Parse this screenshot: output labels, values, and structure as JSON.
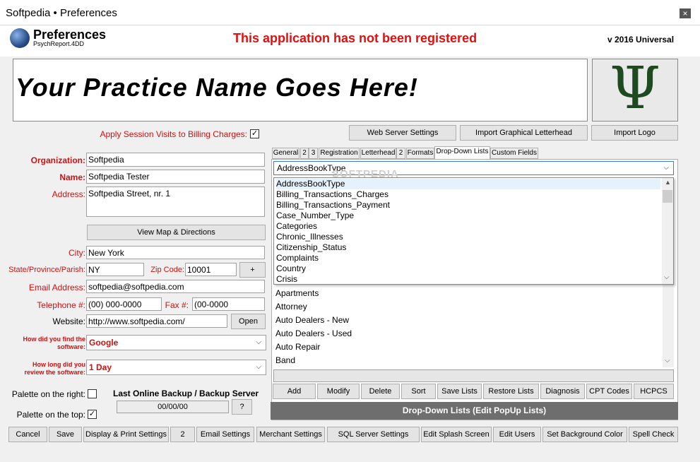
{
  "window": {
    "title": "Softpedia  • Preferences",
    "close_icon": "×"
  },
  "header": {
    "title": "Preferences",
    "subtitle": "PsychReport.4DD",
    "registration_notice": "This application has not been registered",
    "version": "v 2016 Universal"
  },
  "banner": {
    "practice_name": "Your Practice Name Goes Here!",
    "logo_glyph": "Ψ"
  },
  "options": {
    "apply_session_label": "Apply Session Visits to Billing Charges:",
    "apply_session_checked": "✓"
  },
  "top_buttons": {
    "web_server": "Web Server Settings",
    "import_letterhead": "Import Graphical Letterhead",
    "import_logo": "Import Logo"
  },
  "form": {
    "organization_label": "Organization:",
    "organization": "Softpedia",
    "name_label": "Name:",
    "name": "Softpedia Tester",
    "address_label": "Address:",
    "address": "Softpedia Street, nr. 1",
    "view_map": "View Map & Directions",
    "city_label": "City:",
    "city": "New York",
    "state_label": "State/Province/Parish:",
    "state": "NY",
    "zip_label": "Zip Code:",
    "zip": "10001",
    "plus": "+",
    "email_label": "Email Address:",
    "email": "softpedia@softpedia.com",
    "telephone_label": "Telephone #:",
    "telephone": "(00) 000-0000",
    "fax_label": "Fax #:",
    "fax": "(00-0000",
    "website_label": "Website:",
    "website": "http://www.softpedia.com/",
    "open": "Open",
    "found_label_1": "How did you find the",
    "found_label_2": "software:",
    "found_value": "Google",
    "review_label_1": "How long did you",
    "review_label_2": "review the software:",
    "review_value": "1 Day",
    "palette_right_label": "Palette on the right:",
    "palette_right_checked": "",
    "palette_top_label": "Palette on the top:",
    "palette_top_checked": "✓",
    "backup_title": "Last Online Backup / Backup Server",
    "backup_value": "00/00/00",
    "backup_help": "?"
  },
  "tabs": [
    "General",
    "2",
    "3",
    "Registration",
    "Letterhead",
    "2",
    "Formats",
    "Drop-Down Lists",
    "Custom Fields"
  ],
  "dropdown": {
    "selected": "AddressBookType",
    "options": [
      "AddressBookType",
      "Billing_Transactions_Charges",
      "Billing_Transactions_Payment",
      "Case_Number_Type",
      "Categories",
      "Chronic_Illnesses",
      "Citizenship_Status",
      "Complaints",
      "Country",
      "Crisis"
    ],
    "watermark": "SOFTPEDIA"
  },
  "list_items": [
    "Apartments",
    "Attorney",
    "Auto Dealers - New",
    "Auto Dealers - Used",
    "Auto Repair",
    "Band"
  ],
  "list_buttons": [
    "Add",
    "Modify",
    "Delete",
    "Sort",
    "Save Lists",
    "Restore Lists",
    "Diagnosis",
    "CPT Codes",
    "HCPCS"
  ],
  "panel_footer": "Drop-Down Lists (Edit PopUp Lists)",
  "bottom_buttons": [
    "Cancel",
    "Save",
    "Display & Print Settings",
    "2",
    "Email Settings",
    "Merchant Settings",
    "SQL Server Settings",
    "Edit Splash Screen",
    "Edit Users",
    "Set Background Color",
    "Spell Check"
  ],
  "colors": {
    "accent_red": "#d01010",
    "notice_red": "#e01010",
    "footer_bar": "#6e6e6e"
  }
}
